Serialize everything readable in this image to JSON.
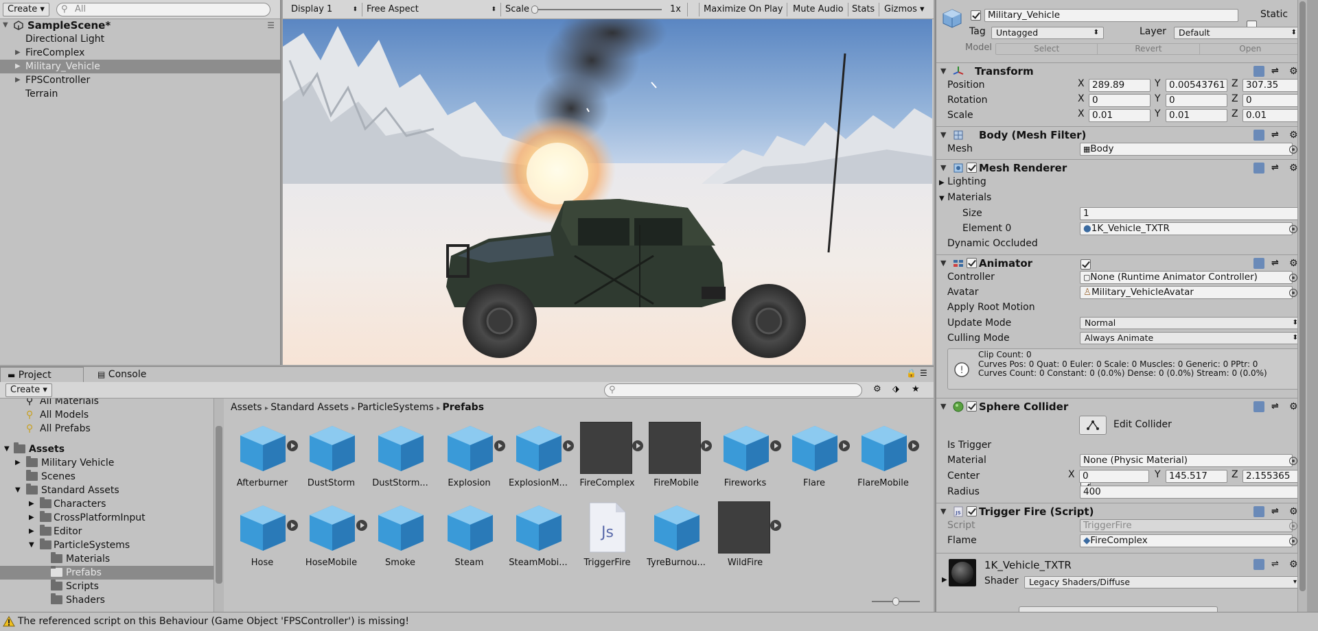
{
  "hierarchy": {
    "create_label": "Create",
    "search_placeholder": "All",
    "scene_name": "SampleScene*",
    "items": [
      {
        "label": "Directional Light"
      },
      {
        "label": "FireComplex"
      },
      {
        "label": "Military_Vehicle"
      },
      {
        "label": "FPSController"
      },
      {
        "label": "Terrain"
      }
    ]
  },
  "scene_toolbar": {
    "display": "Display 1",
    "aspect": "Free Aspect",
    "scale_label": "Scale",
    "scale_value": "1x",
    "maximize": "Maximize On Play",
    "mute": "Mute Audio",
    "stats": "Stats",
    "gizmos": "Gizmos"
  },
  "inspector": {
    "object_name": "Military_Vehicle",
    "static_label": "Static",
    "tag_label": "Tag",
    "tag_value": "Untagged",
    "layer_label": "Layer",
    "layer_value": "Default",
    "model_label": "Model",
    "model_select": "Select",
    "model_revert": "Revert",
    "model_open": "Open",
    "transform": {
      "title": "Transform",
      "position_label": "Position",
      "pos_x": "289.89",
      "pos_y": "0.00543761",
      "pos_z": "307.35",
      "rotation_label": "Rotation",
      "rot_x": "0",
      "rot_y": "0",
      "rot_z": "0",
      "scale_label": "Scale",
      "scale_x": "0.01",
      "scale_y": "0.01",
      "scale_z": "0.01",
      "x": "X",
      "y": "Y",
      "z": "Z"
    },
    "mesh_filter": {
      "title": "Body (Mesh Filter)",
      "mesh_label": "Mesh",
      "mesh_value": "Body"
    },
    "mesh_renderer": {
      "title": "Mesh Renderer",
      "lighting": "Lighting",
      "materials": "Materials",
      "size_label": "Size",
      "size_value": "1",
      "element_label": "Element 0",
      "element_value": "1K_Vehicle_TXTR",
      "dynamic_label": "Dynamic Occluded"
    },
    "animator": {
      "title": "Animator",
      "controller_label": "Controller",
      "controller_value": "None (Runtime Animator Controller)",
      "avatar_label": "Avatar",
      "avatar_value": "Military_VehicleAvatar",
      "root_motion_label": "Apply Root Motion",
      "update_label": "Update Mode",
      "update_value": "Normal",
      "culling_label": "Culling Mode",
      "culling_value": "Always Animate",
      "info_line1": "Clip Count: 0",
      "info_line2": "Curves Pos: 0 Quat: 0 Euler: 0 Scale: 0 Muscles: 0 Generic: 0 PPtr: 0",
      "info_line3": "Curves Count: 0 Constant: 0 (0.0%) Dense: 0 (0.0%) Stream: 0 (0.0%)"
    },
    "sphere_collider": {
      "title": "Sphere Collider",
      "edit_label": "Edit Collider",
      "trigger_label": "Is Trigger",
      "material_label": "Material",
      "material_value": "None (Physic Material)",
      "center_label": "Center",
      "center_x": "0",
      "center_y": "145.517",
      "center_z": "2.155365",
      "radius_label": "Radius",
      "radius_value": "400"
    },
    "trigger_fire": {
      "title": "Trigger Fire (Script)",
      "script_label": "Script",
      "script_value": "TriggerFire",
      "flame_label": "Flame",
      "flame_value": "FireComplex"
    },
    "material": {
      "name": "1K_Vehicle_TXTR",
      "shader_label": "Shader",
      "shader_value": "Legacy Shaders/Diffuse"
    }
  },
  "project": {
    "tab_project": "Project",
    "tab_console": "Console",
    "create_label": "Create",
    "favorites": [
      {
        "label": "All Materials"
      },
      {
        "label": "All Models"
      },
      {
        "label": "All Prefabs"
      }
    ],
    "tree": [
      {
        "label": "Assets"
      },
      {
        "label": "Military Vehicle"
      },
      {
        "label": "Scenes"
      },
      {
        "label": "Standard Assets"
      },
      {
        "label": "Characters"
      },
      {
        "label": "CrossPlatformInput"
      },
      {
        "label": "Editor"
      },
      {
        "label": "ParticleSystems"
      },
      {
        "label": "Materials"
      },
      {
        "label": "Prefabs"
      },
      {
        "label": "Scripts"
      },
      {
        "label": "Shaders"
      }
    ],
    "breadcrumb": [
      "Assets",
      "Standard Assets",
      "ParticleSystems",
      "Prefabs"
    ],
    "assets": [
      {
        "label": "Afterburner"
      },
      {
        "label": "DustStorm"
      },
      {
        "label": "DustStorm..."
      },
      {
        "label": "Explosion"
      },
      {
        "label": "ExplosionM..."
      },
      {
        "label": "FireComplex"
      },
      {
        "label": "FireMobile"
      },
      {
        "label": "Fireworks"
      },
      {
        "label": "Flare"
      },
      {
        "label": "FlareMobile"
      },
      {
        "label": "Hose"
      },
      {
        "label": "HoseMobile"
      },
      {
        "label": "Smoke"
      },
      {
        "label": "Steam"
      },
      {
        "label": "SteamMobi..."
      },
      {
        "label": "TriggerFire"
      },
      {
        "label": "TyreBurnou..."
      },
      {
        "label": "WildFire"
      }
    ],
    "js_glyph": "Js"
  },
  "status": {
    "message": "The referenced script on this Behaviour (Game Object 'FPSController') is missing!"
  }
}
